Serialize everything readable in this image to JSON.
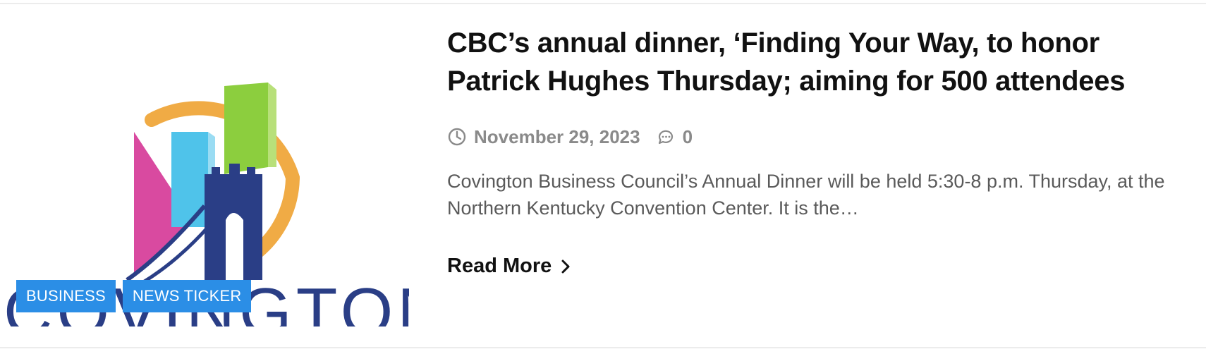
{
  "post": {
    "title": "CBC’s annual dinner, ‘Finding Your Way, to honor Patrick Hughes Thursday; aiming for 500 attendees",
    "date": "November 29, 2023",
    "comments_count": "0",
    "excerpt": "Covington Business Council’s Annual Dinner will be held 5:30-8 p.m. Thursday, at the Northern Kentucky Convention Center. It is the…",
    "read_more_label": "Read More",
    "categories": [
      "BUSINESS",
      "NEWS TICKER"
    ],
    "thumbnail": {
      "logo_text": "COVINGTON",
      "colors": {
        "pink": "#d94aa0",
        "light_blue": "#4fc3ea",
        "green": "#8cce3e",
        "orange": "#f0ab45",
        "navy": "#2a3e86"
      }
    },
    "icons": {
      "date": "clock-icon",
      "comments": "comment-icon",
      "read_more": "chevron-right-icon"
    },
    "accent_color": "#2b8ee6"
  }
}
